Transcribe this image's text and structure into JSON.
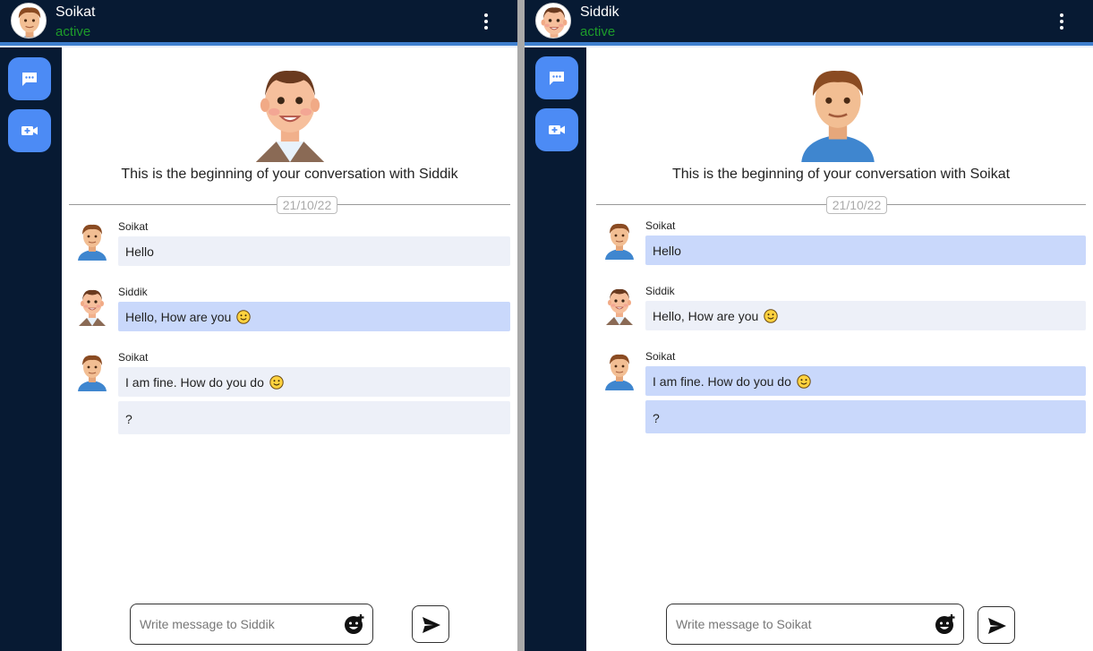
{
  "panes": {
    "left": {
      "header": {
        "name": "Soikat",
        "status": "active"
      },
      "intro": "This is the beginning of your conversation with Siddik",
      "date": "21/10/22",
      "messages": [
        {
          "sender": "Soikat",
          "text": "Hello"
        },
        {
          "sender": "Siddik",
          "text": "Hello, How are you"
        },
        {
          "sender": "Soikat",
          "text": "I am fine. How do you do"
        },
        {
          "text": "?"
        }
      ],
      "input": {
        "placeholder": "Write message to Siddik"
      }
    },
    "right": {
      "header": {
        "name": "Siddik",
        "status": "active"
      },
      "intro": "This is the beginning of your conversation with Soikat",
      "date": "21/10/22",
      "messages": [
        {
          "sender": "Soikat",
          "text": "Hello"
        },
        {
          "sender": "Siddik",
          "text": "Hello, How are you"
        },
        {
          "sender": "Soikat",
          "text": "I am fine. How do you do"
        },
        {
          "text": "?"
        }
      ],
      "input": {
        "placeholder": "Write message to Soikat"
      }
    }
  },
  "icons": {
    "chat": "chat-bubble-icon",
    "video": "video-call-icon",
    "menu": "more-vertical-icon",
    "emoji": "add-emoji-icon",
    "send": "send-icon"
  },
  "colors": {
    "sidebar": "#071a33",
    "accent": "#4c8bf5",
    "status": "#1d9b2a",
    "own_bubble": "#c9d8fb",
    "other_bubble": "#edf0f8"
  }
}
